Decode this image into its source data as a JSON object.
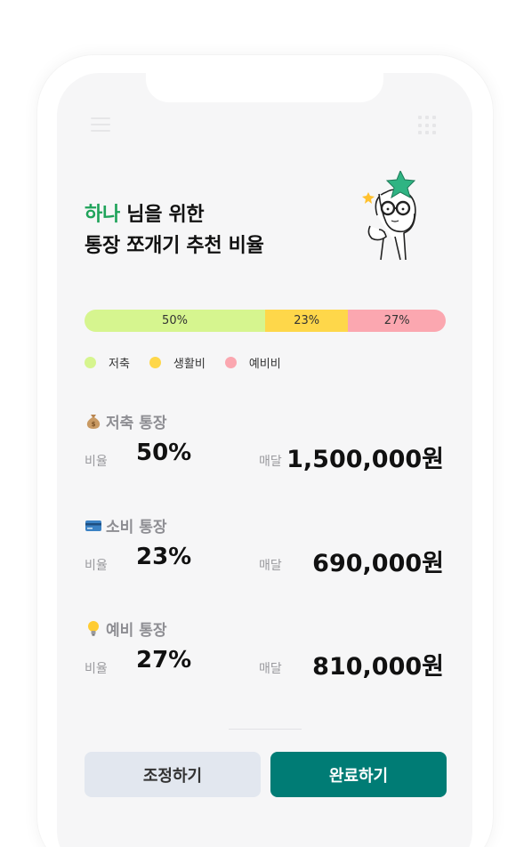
{
  "header": {
    "brand_name": "하나",
    "title_line1_rest": " 님을 위한",
    "title_line2": "통장 쪼개기 추천 비율"
  },
  "ratio_bar": {
    "segments": [
      {
        "label": "50%",
        "value": 50,
        "color": "#d6f58f"
      },
      {
        "label": "23%",
        "value": 23,
        "color": "#fed74a"
      },
      {
        "label": "27%",
        "value": 27,
        "color": "#fba7b0"
      }
    ]
  },
  "legend": [
    {
      "label": "저축",
      "color": "#d6f58f"
    },
    {
      "label": "생활비",
      "color": "#fed74a"
    },
    {
      "label": "예비비",
      "color": "#fba7b0"
    }
  ],
  "accounts": [
    {
      "icon": "money-bag-icon",
      "title": "저축 통장",
      "ratio_label": "비율",
      "ratio": "50%",
      "monthly_label": "매달",
      "amount": "1,500,000원"
    },
    {
      "icon": "credit-card-icon",
      "title": "소비 통장",
      "ratio_label": "비율",
      "ratio": "23%",
      "monthly_label": "매달",
      "amount": "690,000원"
    },
    {
      "icon": "light-bulb-icon",
      "title": "예비 통장",
      "ratio_label": "비율",
      "ratio": "27%",
      "monthly_label": "매달",
      "amount": "810,000원"
    }
  ],
  "buttons": {
    "adjust": "조정하기",
    "done": "완료하기"
  },
  "colors": {
    "brand_green": "#1fa35a",
    "primary_button": "#007c75",
    "secondary_button": "#e2e7ef"
  }
}
